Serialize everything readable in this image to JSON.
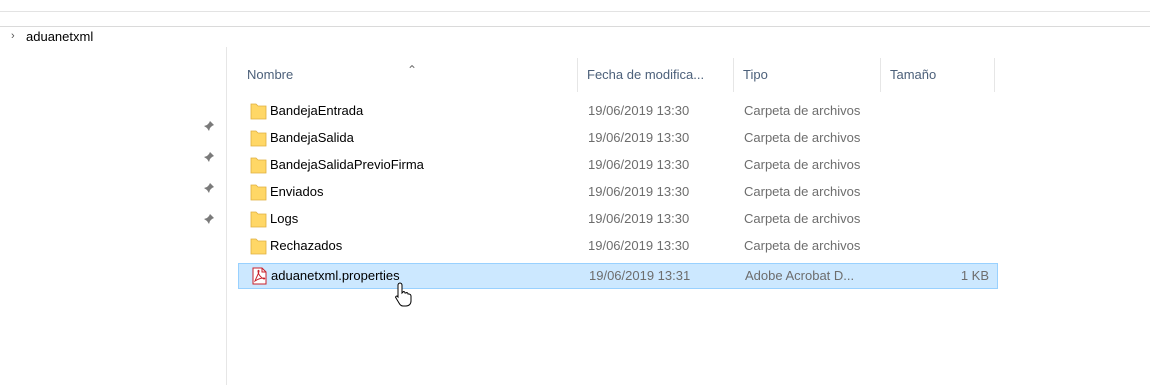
{
  "address": {
    "path": "aduanetxml"
  },
  "columns": {
    "name": "Nombre",
    "date": "Fecha de modifica...",
    "type": "Tipo",
    "size": "Tamaño"
  },
  "files": [
    {
      "name": "BandejaEntrada",
      "date": "19/06/2019 13:30",
      "type": "Carpeta de archivos",
      "size": "",
      "icon": "folder-icon"
    },
    {
      "name": "BandejaSalida",
      "date": "19/06/2019 13:30",
      "type": "Carpeta de archivos",
      "size": "",
      "icon": "folder-icon"
    },
    {
      "name": "BandejaSalidaPrevioFirma",
      "date": "19/06/2019 13:30",
      "type": "Carpeta de archivos",
      "size": "",
      "icon": "folder-icon"
    },
    {
      "name": "Enviados",
      "date": "19/06/2019 13:30",
      "type": "Carpeta de archivos",
      "size": "",
      "icon": "folder-icon"
    },
    {
      "name": "Logs",
      "date": "19/06/2019 13:30",
      "type": "Carpeta de archivos",
      "size": "",
      "icon": "folder-icon"
    },
    {
      "name": "Rechazados",
      "date": "19/06/2019 13:30",
      "type": "Carpeta de archivos",
      "size": "",
      "icon": "folder-icon"
    },
    {
      "name": "aduanetxml.properties",
      "date": "19/06/2019 13:31",
      "type": "Adobe Acrobat D...",
      "size": "1 KB",
      "icon": "pdf-file-icon",
      "selected": true
    }
  ],
  "colors": {
    "folder": "#ffd766",
    "selection_bg": "#cce8ff",
    "selection_border": "#99d1ff",
    "header_text": "#4c607a",
    "secondary_text": "#6d6d6d"
  }
}
